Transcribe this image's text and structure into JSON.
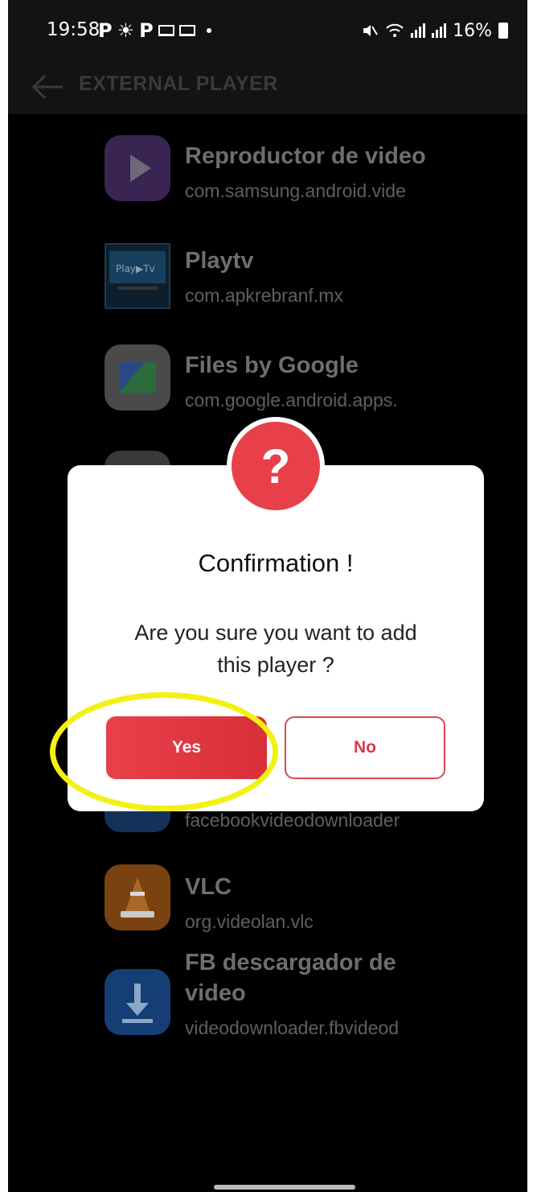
{
  "status_bar": {
    "time": "19:58",
    "battery": "16%"
  },
  "app_bar": {
    "title": "EXTERNAL PLAYER",
    "back_icon": "arrow-left-icon"
  },
  "players": [
    {
      "name": "Reproductor de video",
      "package": "com.samsung.android.vide",
      "icon": "play-icon",
      "color": "#4a2c63"
    },
    {
      "name": "Playtv",
      "package": "com.apkrebranf.mx",
      "icon": "tv-icon",
      "color": "#1b3a52"
    },
    {
      "name": "Files by Google",
      "package": "com.google.android.apps.",
      "icon": "folder-icon",
      "color": "#5e5e5e"
    },
    {
      "name": "",
      "package": "facebookvideodownloader",
      "icon": "download-icon",
      "color": "#14315a"
    },
    {
      "name": "VLC",
      "package": "org.videolan.vlc",
      "icon": "cone-icon",
      "color": "#8a4a10"
    },
    {
      "name": "FB descargador de video",
      "name_line1": "FB descargador de",
      "name_line2": "video",
      "package": "videodownloader.fbvideod",
      "icon": "download-icon",
      "color": "#1a4a86"
    }
  ],
  "dialog": {
    "badge": "?",
    "title": "Confirmation !",
    "message_line1": "Are you sure you want to add",
    "message_line2": "this player ?",
    "yes_label": "Yes",
    "no_label": "No"
  },
  "colors": {
    "accent": "#e8404a",
    "highlight": "#f4f012"
  }
}
